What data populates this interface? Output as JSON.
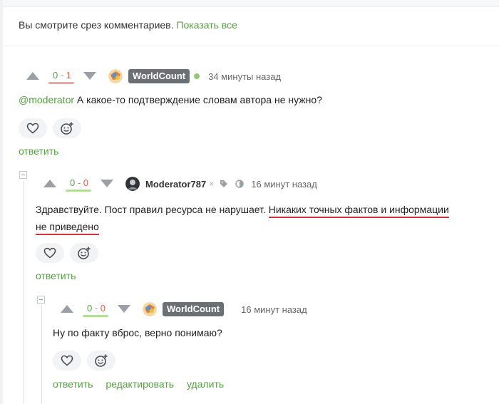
{
  "banner": {
    "text": "Вы смотрите срез комментариев.",
    "link": "Показать все"
  },
  "comments": [
    {
      "score_pos": "0",
      "score_sep": "-",
      "score_neg": "1",
      "author": "WorldCount",
      "time": "34 минуты назад",
      "mention": "@moderator",
      "text": "А какое-то подтверждение словам автора не нужно?",
      "reply_label": "ответить"
    },
    {
      "score_pos": "0",
      "score_sep": "-",
      "score_neg": "0",
      "author": "Moderator787",
      "cross": "×",
      "time": "16 минут назад",
      "text_plain": "Здравствуйте. Пост правил ресурса не нарушает.",
      "text_underlined_1": "Никаких точных фактов и информации",
      "text_underlined_2": "не приведено",
      "reply_label": "ответить"
    },
    {
      "score_pos": "0",
      "score_sep": "-",
      "score_neg": "0",
      "author": "WorldCount",
      "time": "16 минут назад",
      "text": "Ну по факту вброс, верно понимаю?",
      "reply_label": "ответить",
      "edit_label": "редактировать",
      "delete_label": "удалить"
    }
  ],
  "colors": {
    "accent": "#54a33f",
    "negative": "#e0604f",
    "underline": "#d3303e",
    "badge": "#6b7075"
  },
  "icons": [
    "heart-icon",
    "smiley-add-icon",
    "arrow-up-icon",
    "arrow-down-icon",
    "tag-icon",
    "moon-icon",
    "collapse-icon"
  ]
}
